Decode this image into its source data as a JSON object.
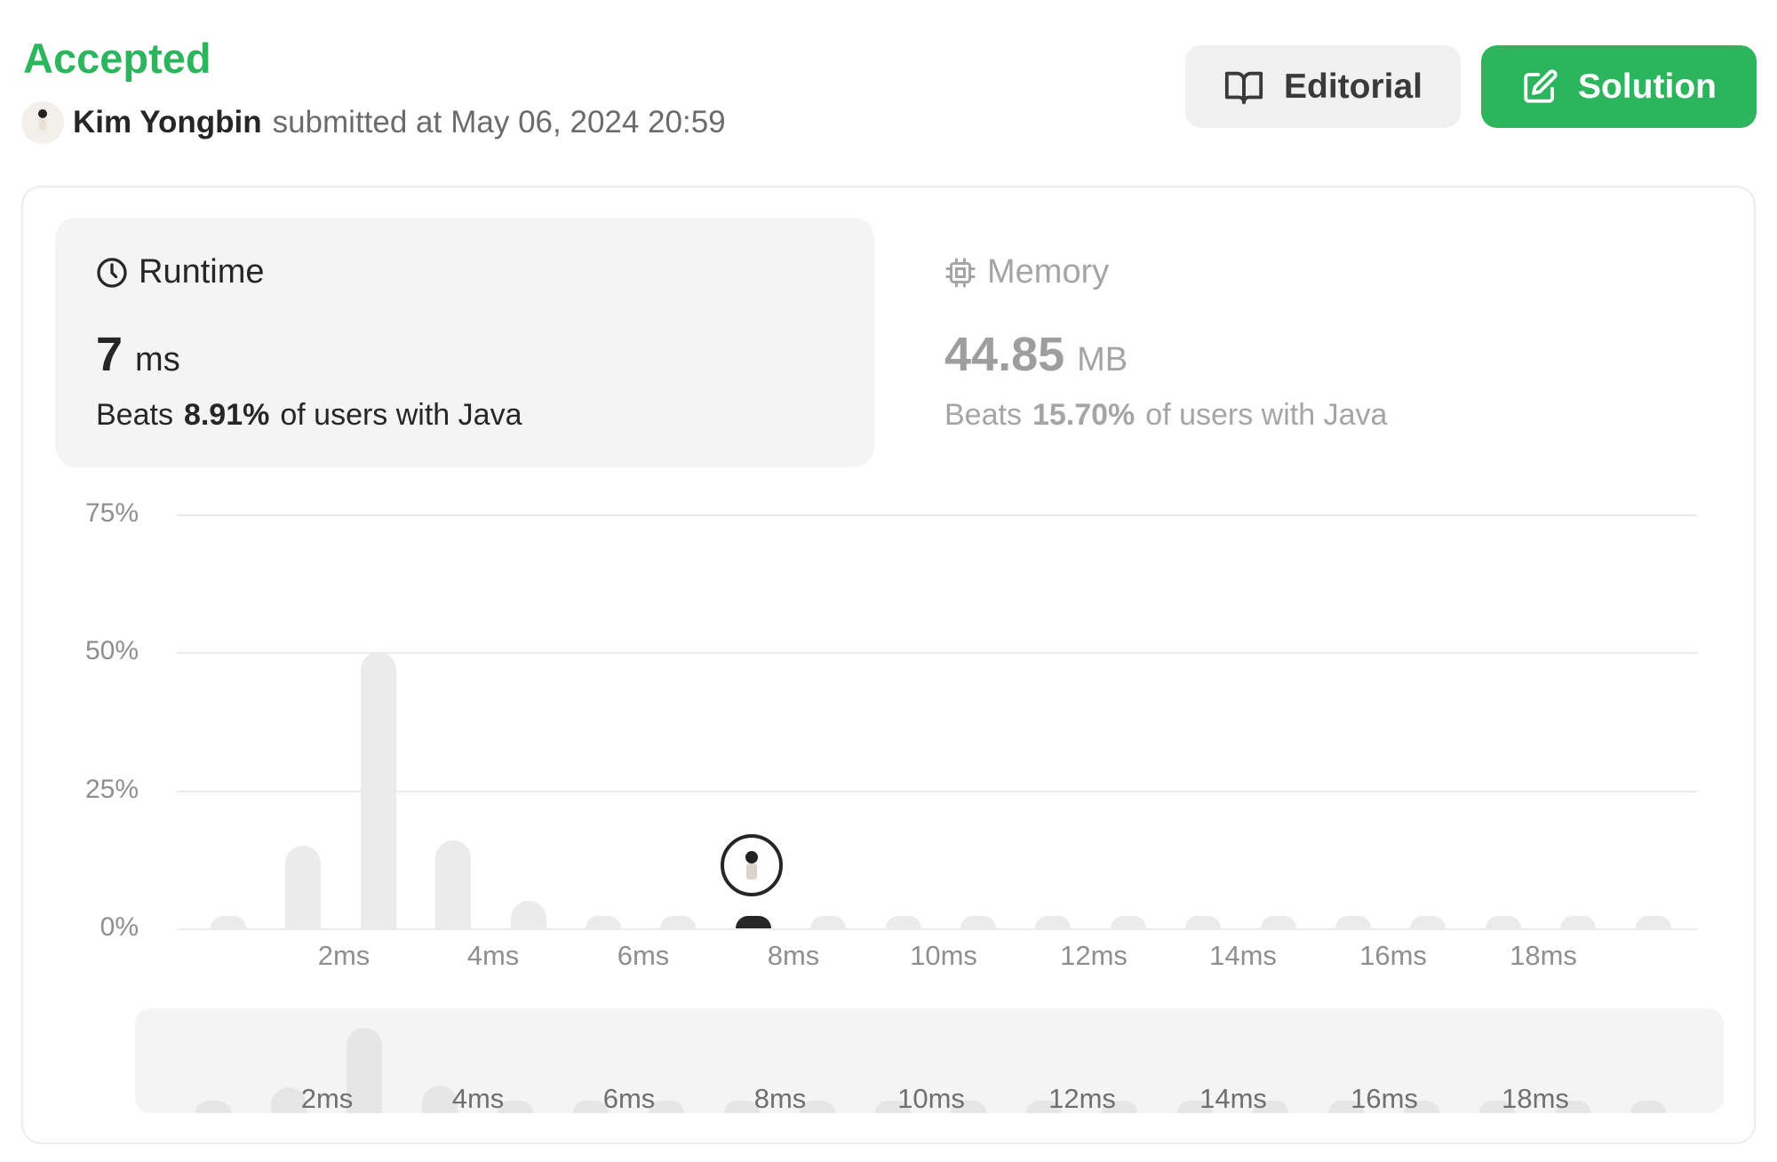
{
  "header": {
    "status": "Accepted",
    "username": "Kim Yongbin",
    "submitted_label": "submitted at",
    "submitted_time": "May 06, 2024 20:59",
    "editorial_label": "Editorial",
    "solution_label": "Solution",
    "icons": {
      "editorial": "book-open-icon",
      "solution": "edit-icon"
    },
    "colors": {
      "accepted": "#2db55d",
      "solution_button": "#2db55d"
    }
  },
  "runtime": {
    "title": "Runtime",
    "icon": "clock-icon",
    "value": "7",
    "unit": "ms",
    "beats_prefix": "Beats",
    "beats_pct": "8.91%",
    "beats_suffix": "of users with Java"
  },
  "memory": {
    "title": "Memory",
    "icon": "cpu-icon",
    "value": "44.85",
    "unit": "MB",
    "beats_prefix": "Beats",
    "beats_pct": "15.70%",
    "beats_suffix": "of users with Java"
  },
  "chart_data": {
    "type": "bar",
    "x_unit": "ms",
    "x": [
      0.5,
      1.5,
      2.5,
      3.5,
      4.5,
      5.5,
      6.5,
      7.5,
      8.5,
      9.5,
      10.5,
      11.5,
      12.5,
      13.5,
      14.5,
      15.5,
      16.5,
      17.5,
      18.5,
      19.5
    ],
    "values": [
      0.6,
      15,
      50,
      16,
      5,
      0.6,
      0.6,
      2,
      0.6,
      0.6,
      0.6,
      0.6,
      0.6,
      0.6,
      0.6,
      0.6,
      0.6,
      0.6,
      0.6,
      0.6
    ],
    "active_x": 7.5,
    "yticks": [
      "75%",
      "50%",
      "25%",
      "0%"
    ],
    "ylim": [
      0,
      75
    ],
    "xticks": [
      "2ms",
      "4ms",
      "6ms",
      "8ms",
      "10ms",
      "12ms",
      "14ms",
      "16ms",
      "18ms"
    ],
    "xtick_values": [
      2,
      4,
      6,
      8,
      10,
      12,
      14,
      16,
      18
    ],
    "grid": true,
    "bar_color": "#ebebeb",
    "active_color": "#262626"
  },
  "overview": {
    "xticks": [
      "2ms",
      "4ms",
      "6ms",
      "8ms",
      "10ms",
      "12ms",
      "14ms",
      "16ms",
      "18ms"
    ]
  }
}
